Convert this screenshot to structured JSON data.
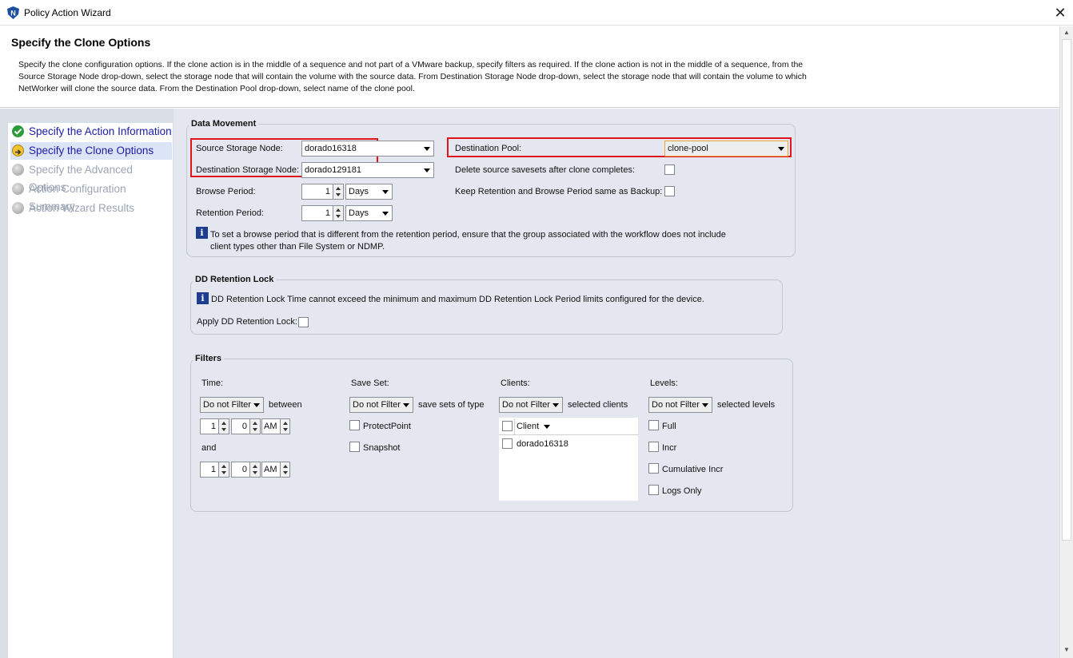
{
  "window": {
    "title": "Policy Action Wizard",
    "close_icon": "close-icon",
    "app_icon": "networker-shield-icon"
  },
  "header": {
    "title": "Specify the Clone Options",
    "description": "Specify the clone configuration options. If the clone action is in the middle of a sequence and not part of a VMware backup, specify filters as required. If the clone action is not in the middle of a sequence, from the Source Storage Node drop-down, select the storage node that will contain the volume with the source data. From Destination Storage Node drop-down, select the storage node that will contain the volume to which NetWorker will clone the source data. From the Destination Pool drop-down, select name of the clone pool."
  },
  "nav": {
    "items": [
      {
        "label": "Specify the Action Information",
        "state": "done",
        "icon": "check-icon"
      },
      {
        "label": "Specify the Clone Options",
        "state": "current",
        "icon": "arrow-icon"
      },
      {
        "label": "Specify the Advanced Options",
        "state": "pending",
        "icon": "gray-dot-icon"
      },
      {
        "label": "Action Configuration Summary",
        "state": "pending",
        "icon": "gray-dot-icon"
      },
      {
        "label": "Action Wizard Results",
        "state": "pending",
        "icon": "gray-dot-icon"
      }
    ]
  },
  "data_movement": {
    "title": "Data Movement",
    "source_node_label": "Source Storage Node:",
    "source_node_value": "dorado16318",
    "dest_node_label": "Destination Storage Node:",
    "dest_node_value": "dorado129181",
    "browse_label": "Browse Period:",
    "browse_value": "1",
    "browse_unit": "Days",
    "retention_label": "Retention Period:",
    "retention_value": "1",
    "retention_unit": "Days",
    "dest_pool_label": "Destination Pool:",
    "dest_pool_value": "clone-pool",
    "delete_source_label": "Delete source savesets after clone completes:",
    "keep_retention_label": "Keep Retention and Browse Period same as Backup:",
    "info_text": "To set a browse period that is different from the retention period, ensure that the group associated with the workflow does not include client types other than File System or NDMP."
  },
  "dd_retention": {
    "title": "DD Retention Lock",
    "info_text": "DD Retention Lock Time cannot exceed the minimum and maximum DD Retention Lock Period limits configured for the device.",
    "apply_label": "Apply DD Retention Lock:"
  },
  "filters": {
    "title": "Filters",
    "time": {
      "label": "Time:",
      "filter_value": "Do not Filter",
      "between_label": "between",
      "and_label": "and",
      "start": {
        "hour": "1",
        "minute": "0",
        "ampm": "AM"
      },
      "end": {
        "hour": "1",
        "minute": "0",
        "ampm": "AM"
      }
    },
    "save_set": {
      "label": "Save Set:",
      "filter_value": "Do not Filter",
      "suffix": "save sets of type",
      "options": [
        "ProtectPoint",
        "Snapshot"
      ]
    },
    "clients": {
      "label": "Clients:",
      "filter_value": "Do not Filter",
      "suffix": "selected clients",
      "column_header": "Client",
      "rows": [
        "dorado16318"
      ]
    },
    "levels": {
      "label": "Levels:",
      "filter_value": "Do not Filter",
      "suffix": "selected levels",
      "options": [
        "Full",
        "Incr",
        "Cumulative Incr",
        "Logs Only"
      ]
    }
  },
  "colors": {
    "highlight_box": "#e0141b",
    "panel_bg": "#e4e7ef",
    "nav_text": "#1a1aa6"
  }
}
